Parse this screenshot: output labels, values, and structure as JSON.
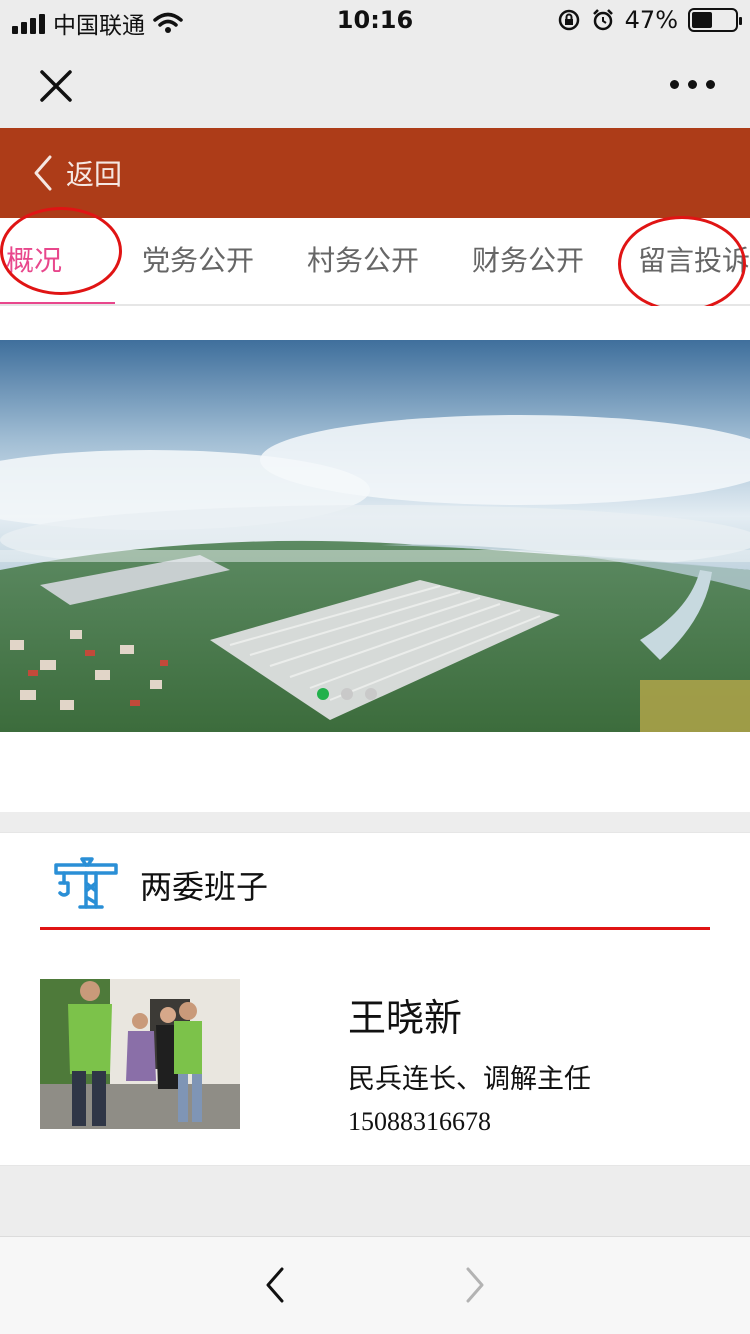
{
  "status_bar": {
    "carrier": "中国联通",
    "time": "10:16",
    "battery_percent": "47%",
    "battery_level": 0.47
  },
  "nav": {
    "close_icon": "close-icon",
    "more_icon": "more-dots-icon"
  },
  "header": {
    "back_label": "返回",
    "accent_color": "#ad3c18"
  },
  "tabs": [
    {
      "label": "概况",
      "active": true
    },
    {
      "label": "党务公开",
      "active": false
    },
    {
      "label": "村务公开",
      "active": false
    },
    {
      "label": "财务公开",
      "active": false
    },
    {
      "label": "留言投诉",
      "active": false
    }
  ],
  "banner": {
    "slide_count": 3,
    "active_slide": 1
  },
  "section": {
    "icon": "crane-icon",
    "title": "两委班子",
    "members": [
      {
        "name": "王晓新",
        "role": "民兵连长、调解主任",
        "phone": "15088316678"
      }
    ]
  },
  "colors": {
    "active_tab": "#e8478c",
    "divider_red": "#e01414",
    "dot_active": "#22b14c",
    "icon_blue": "#2a8fd6"
  }
}
